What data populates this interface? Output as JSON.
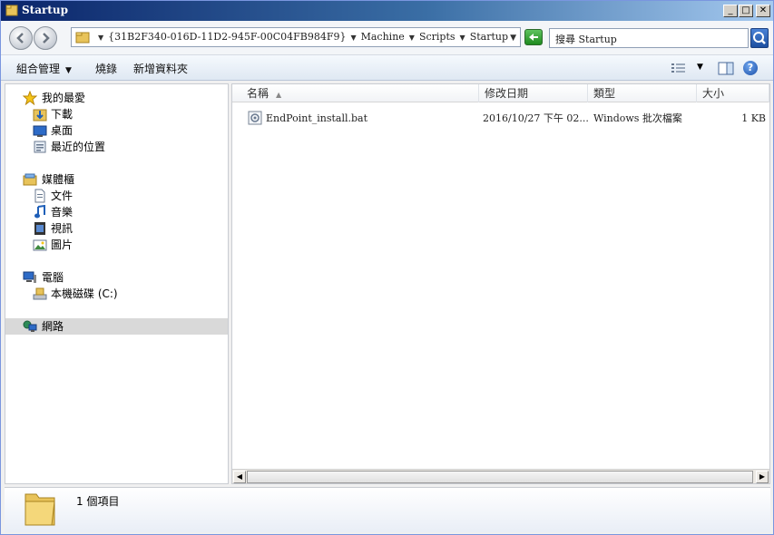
{
  "window": {
    "title": "Startup",
    "controls": {
      "minimize": "_",
      "maximize": "□",
      "close": "✕"
    }
  },
  "address": {
    "crumbs": [
      "{31B2F340-016D-11D2-945F-00C04FB984F9}",
      "Machine",
      "Scripts",
      "Startup"
    ],
    "search_placeholder": "搜尋 Startup"
  },
  "toolbar": {
    "organize": "組合管理",
    "burn": "燒錄",
    "new_folder": "新增資料夾"
  },
  "nav": {
    "favorites": {
      "label": "我的最愛",
      "items": [
        "下載",
        "桌面",
        "最近的位置"
      ]
    },
    "libraries": {
      "label": "媒體櫃",
      "items": [
        "文件",
        "音樂",
        "視訊",
        "圖片"
      ]
    },
    "computer": {
      "label": "電腦",
      "items": [
        "本機磁碟 (C:)"
      ]
    },
    "network": {
      "label": "網路"
    }
  },
  "columns": {
    "name": "名稱",
    "date": "修改日期",
    "type": "類型",
    "size": "大小"
  },
  "files": [
    {
      "name": "EndPoint_install.bat",
      "date": "2016/10/27 下午 02...",
      "type": "Windows 批次檔案",
      "size": "1 KB"
    }
  ],
  "details": {
    "count": "1 個項目"
  },
  "icons": [
    "folder-icon",
    "back-icon",
    "forward-icon",
    "refresh-icon",
    "search-icon",
    "view-icon",
    "preview-pane-icon",
    "help-icon",
    "star-icon",
    "download-icon",
    "desktop-icon",
    "recent-icon",
    "library-icon",
    "document-icon",
    "music-icon",
    "video-icon",
    "picture-icon",
    "computer-icon",
    "drive-icon",
    "network-icon",
    "batch-file-icon"
  ],
  "colors": {
    "title_gradient_start": "#0a246a",
    "selection": "#d9d9d9",
    "toolbar_bg": "#dfe8f3"
  }
}
